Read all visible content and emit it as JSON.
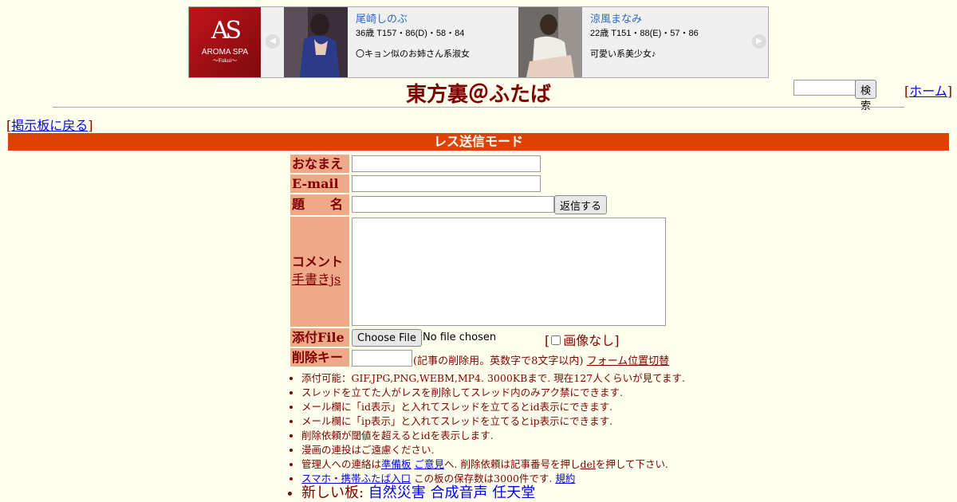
{
  "ad": {
    "logo_mark": "AS",
    "logo_text": "AROMA SPA",
    "logo_sub": "〜Fukui〜",
    "prev_icon": "◀",
    "next_icon": "▶",
    "cards": [
      {
        "name": "尾崎しのぶ",
        "stats": "36歳 T157・86(D)・58・84",
        "desc": "〇キョン似のお姉さん系淑女"
      },
      {
        "name": "涼風まなみ",
        "stats": "22歳 T151・88(E)・57・86",
        "desc": "可愛い系美少女♪"
      }
    ]
  },
  "header": {
    "title": "東方裏＠ふたば",
    "search_button": "検索",
    "home_prefix": "[",
    "home_link": "ホーム",
    "home_suffix": "]"
  },
  "nav": {
    "back_prefix": "[",
    "back_link": "掲示板に戻る",
    "back_suffix": "]"
  },
  "mode_label": "レス送信モード",
  "form": {
    "name_label": "おなまえ",
    "email_label": "E-mail",
    "subject_label": "題　　名",
    "submit_label": "返信する",
    "comment_label": "コメント",
    "handwrite_link": "手書きjs",
    "file_label": "添付File",
    "choose_file": "Choose File",
    "no_file": "No file chosen",
    "noimage_open": "[",
    "noimage_label": "画像なし]",
    "delkey_label": "削除キー",
    "delkey_note": "(記事の削除用。英数字で8文字以内)",
    "form_toggle": "フォーム位置切替"
  },
  "rules": {
    "r1": "添付可能：GIF,JPG,PNG,WEBM,MP4. 3000KBまで. 現在127人くらいが見てます.",
    "r2": "スレッドを立てた人がレスを削除してスレッド内のみアク禁にできます.",
    "r3": "メール欄に「id表示」と入れてスレッドを立てるとid表示にできます.",
    "r4": "メール欄に「ip表示」と入れてスレッドを立てるとip表示にできます.",
    "r5": "削除依頼が閾値を超えるとidを表示します.",
    "r6": "漫画の連投はご遠慮ください.",
    "r7_pre": "管理人への連絡は",
    "r7_link1": "準備板",
    "r7_link2": "ご意見",
    "r7_mid": "へ. 削除依頼は記事番号を押し",
    "r7_del": "del",
    "r7_post": "を押して下さい.",
    "r8_link": "スマホ・携帯ふたば入口",
    "r8_mid": "この板の保存数は3000件です.",
    "r8_rule": "規約",
    "r9_pre": "新しい板: ",
    "r9_links": [
      "自然災害",
      "合成音声",
      "任天堂"
    ]
  }
}
